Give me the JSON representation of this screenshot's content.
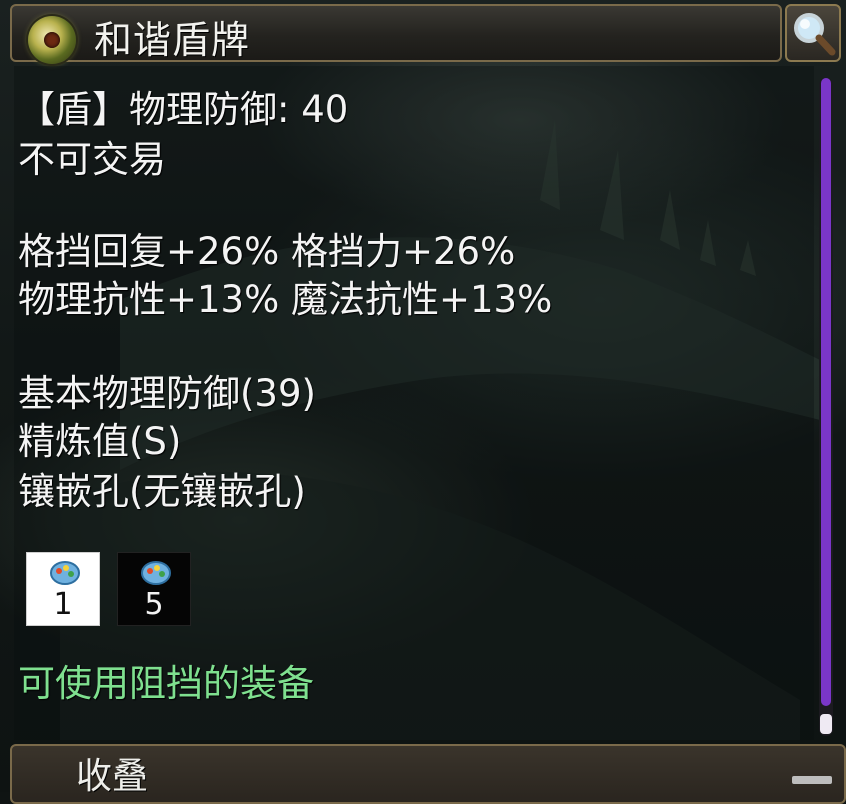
{
  "window": {
    "title": "和谐盾牌"
  },
  "item": {
    "lines": [
      "【盾】物理防御: 40",
      "不可交易",
      "",
      "格挡回复+26% 格挡力+26%",
      "物理抗性+13% 魔法抗性+13%",
      "",
      "基本物理防御(39)",
      "精炼值(S)",
      "镶嵌孔(无镶嵌孔)"
    ],
    "gems": [
      {
        "count": "1",
        "background": "#ffffff"
      },
      {
        "count": "5",
        "background": "#050505"
      }
    ],
    "usage_note": "可使用阻挡的装备"
  },
  "footer": {
    "label": "收叠"
  },
  "colors": {
    "frame_border": "#7a6a4a",
    "scroll_thumb": "#7a36c8",
    "usage_note": "#7fe08f"
  },
  "icons": {
    "title": "shield-item-icon",
    "search": "magnifier-icon",
    "gem": "gem-palette-icon",
    "collapse": "minus-icon"
  }
}
